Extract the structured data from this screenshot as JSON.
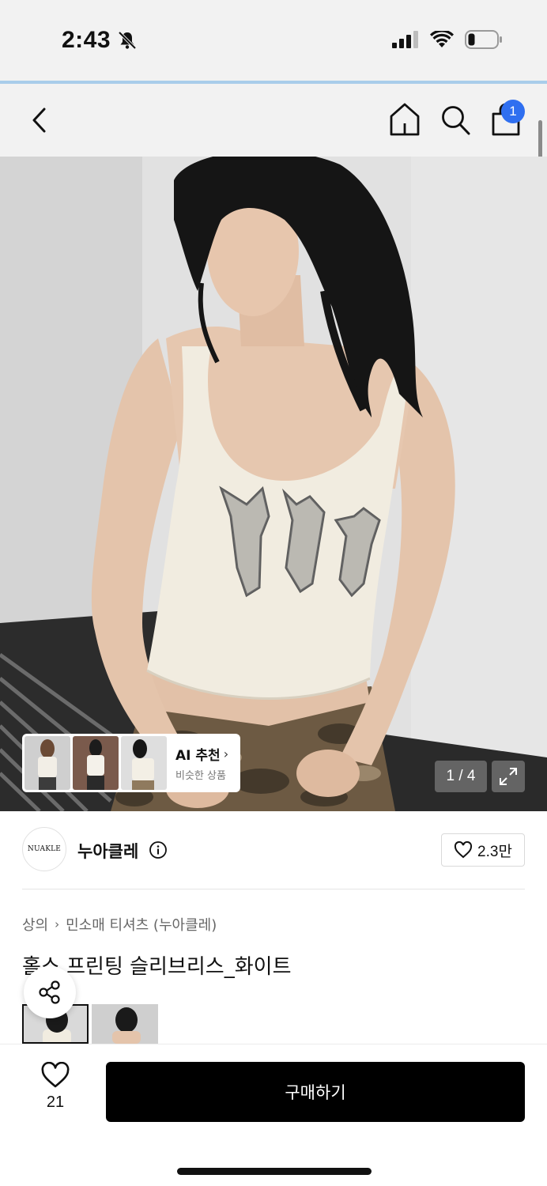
{
  "status_bar": {
    "time": "2:43",
    "bell_icon": "bell-slash-icon",
    "signal_icon": "cellular-signal-icon",
    "wifi_icon": "wifi-icon",
    "battery_icon": "battery-low-icon"
  },
  "nav": {
    "back_icon": "chevron-left-icon",
    "home_icon": "home-icon",
    "search_icon": "search-icon",
    "cart_icon": "shopping-bag-icon",
    "cart_badge": "1"
  },
  "hero": {
    "page_counter": "1 / 4",
    "expand_icon": "expand-icon"
  },
  "ai_recommend": {
    "title": "AI 추천",
    "subtitle": "비슷한 상품"
  },
  "brand": {
    "logo_text": "NUAKLE",
    "name": "누아클레",
    "like_count": "2.3만"
  },
  "breadcrumb": {
    "category": "상의",
    "subcategory": "민소매 티셔츠 (누아클레)"
  },
  "product": {
    "title": "홀스 프린팅 슬리브리스_화이트"
  },
  "bottom": {
    "wish_count": "21",
    "buy_label": "구매하기"
  },
  "colors": {
    "accent_blue": "#2f6ff0",
    "buy_button": "#000000",
    "status_bg": "#f2f2f2"
  }
}
